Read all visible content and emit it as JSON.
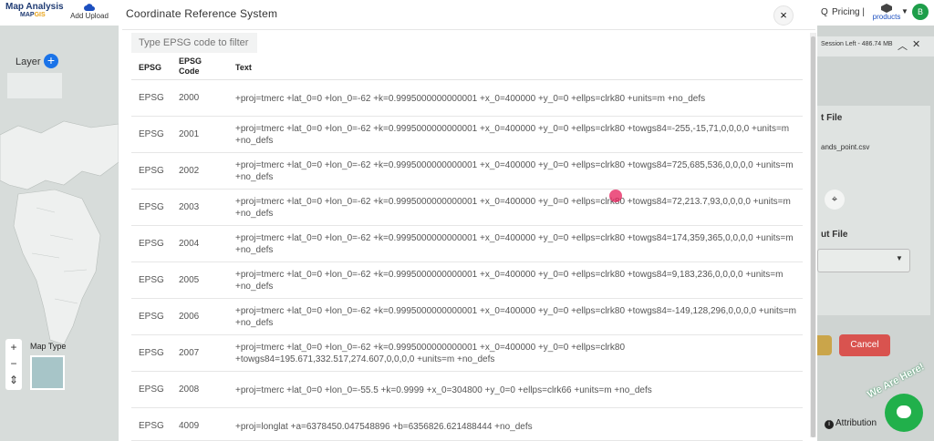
{
  "app": {
    "name": "Map Analysis",
    "sub_prefix": "MAP",
    "sub_suffix": "GIS",
    "add_upload": "Add Upload",
    "pricing": "Pricing |",
    "q": "Q",
    "products": "products",
    "avatar_initial": "B"
  },
  "left": {
    "layer_label": "Layer",
    "map_type_label": "Map Type",
    "zoom_in": "+",
    "zoom_out": "−",
    "reset": "⇕"
  },
  "right": {
    "session": "Session Left - 486.74 MB",
    "input_title": "t File",
    "file_name": "ands_point.csv",
    "output_title": "ut File",
    "cancel_label": "Cancel",
    "chat_badge": "We Are Here!",
    "attribution": "Attribution"
  },
  "modal": {
    "title": "Coordinate Reference System",
    "close": "×",
    "filter_placeholder": "Type EPSG code to filter",
    "headers": {
      "epsg": "EPSG",
      "code": "EPSG Code",
      "text": "Text"
    },
    "rows": [
      {
        "epsg": "EPSG",
        "code": "2000",
        "text": "+proj=tmerc +lat_0=0 +lon_0=-62 +k=0.9995000000000001 +x_0=400000 +y_0=0 +ellps=clrk80 +units=m +no_defs"
      },
      {
        "epsg": "EPSG",
        "code": "2001",
        "text": "+proj=tmerc +lat_0=0 +lon_0=-62 +k=0.9995000000000001 +x_0=400000 +y_0=0 +ellps=clrk80 +towgs84=-255,-15,71,0,0,0,0 +units=m +no_defs"
      },
      {
        "epsg": "EPSG",
        "code": "2002",
        "text": "+proj=tmerc +lat_0=0 +lon_0=-62 +k=0.9995000000000001 +x_0=400000 +y_0=0 +ellps=clrk80 +towgs84=725,685,536,0,0,0,0 +units=m +no_defs"
      },
      {
        "epsg": "EPSG",
        "code": "2003",
        "text": "+proj=tmerc +lat_0=0 +lon_0=-62 +k=0.9995000000000001 +x_0=400000 +y_0=0 +ellps=clrk80 +towgs84=72,213.7,93,0,0,0,0 +units=m +no_defs"
      },
      {
        "epsg": "EPSG",
        "code": "2004",
        "text": "+proj=tmerc +lat_0=0 +lon_0=-62 +k=0.9995000000000001 +x_0=400000 +y_0=0 +ellps=clrk80 +towgs84=174,359,365,0,0,0,0 +units=m +no_defs"
      },
      {
        "epsg": "EPSG",
        "code": "2005",
        "text": "+proj=tmerc +lat_0=0 +lon_0=-62 +k=0.9995000000000001 +x_0=400000 +y_0=0 +ellps=clrk80 +towgs84=9,183,236,0,0,0,0 +units=m +no_defs"
      },
      {
        "epsg": "EPSG",
        "code": "2006",
        "text": "+proj=tmerc +lat_0=0 +lon_0=-62 +k=0.9995000000000001 +x_0=400000 +y_0=0 +ellps=clrk80 +towgs84=-149,128,296,0,0,0,0 +units=m +no_defs"
      },
      {
        "epsg": "EPSG",
        "code": "2007",
        "text": "+proj=tmerc +lat_0=0 +lon_0=-62 +k=0.9995000000000001 +x_0=400000 +y_0=0 +ellps=clrk80 +towgs84=195.671,332.517,274.607,0,0,0,0 +units=m +no_defs"
      },
      {
        "epsg": "EPSG",
        "code": "2008",
        "text": "+proj=tmerc +lat_0=0 +lon_0=-55.5 +k=0.9999 +x_0=304800 +y_0=0 +ellps=clrk66 +units=m +no_defs"
      },
      {
        "epsg": "EPSG",
        "code": "4009",
        "text": "+proj=longlat +a=6378450.047548896 +b=6356826.621488444 +no_defs"
      }
    ]
  },
  "colors": {
    "accent": "#1a73e8",
    "cancel": "#d9534f",
    "chat": "#21b04b",
    "avatar": "#1e9e4a"
  }
}
